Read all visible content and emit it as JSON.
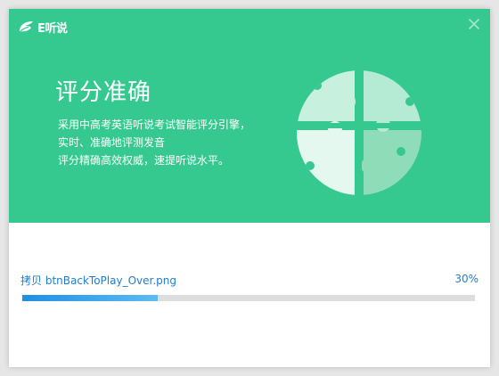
{
  "app": {
    "logo_text": "E听说"
  },
  "banner": {
    "headline": "评分准确",
    "description_lines": [
      "采用中高考英语听说考试智能评分引擎，",
      "实时、准确地评测发音",
      "评分精确高效权威，速提听说水平。"
    ]
  },
  "progress": {
    "action": "拷贝",
    "file": "btnBackToPlay_Over.png",
    "percent_label": "30%",
    "fraction": 0.3
  },
  "colors": {
    "banner": "#36c98f",
    "accent_text": "#1f7ccf",
    "bar_start": "#1e8fe6",
    "bar_end": "#5bbcf2",
    "track": "#dddddd"
  },
  "icons": {
    "logo": "leaf-logo-icon",
    "close": "close-icon",
    "illustration": "puzzle-illustration"
  }
}
